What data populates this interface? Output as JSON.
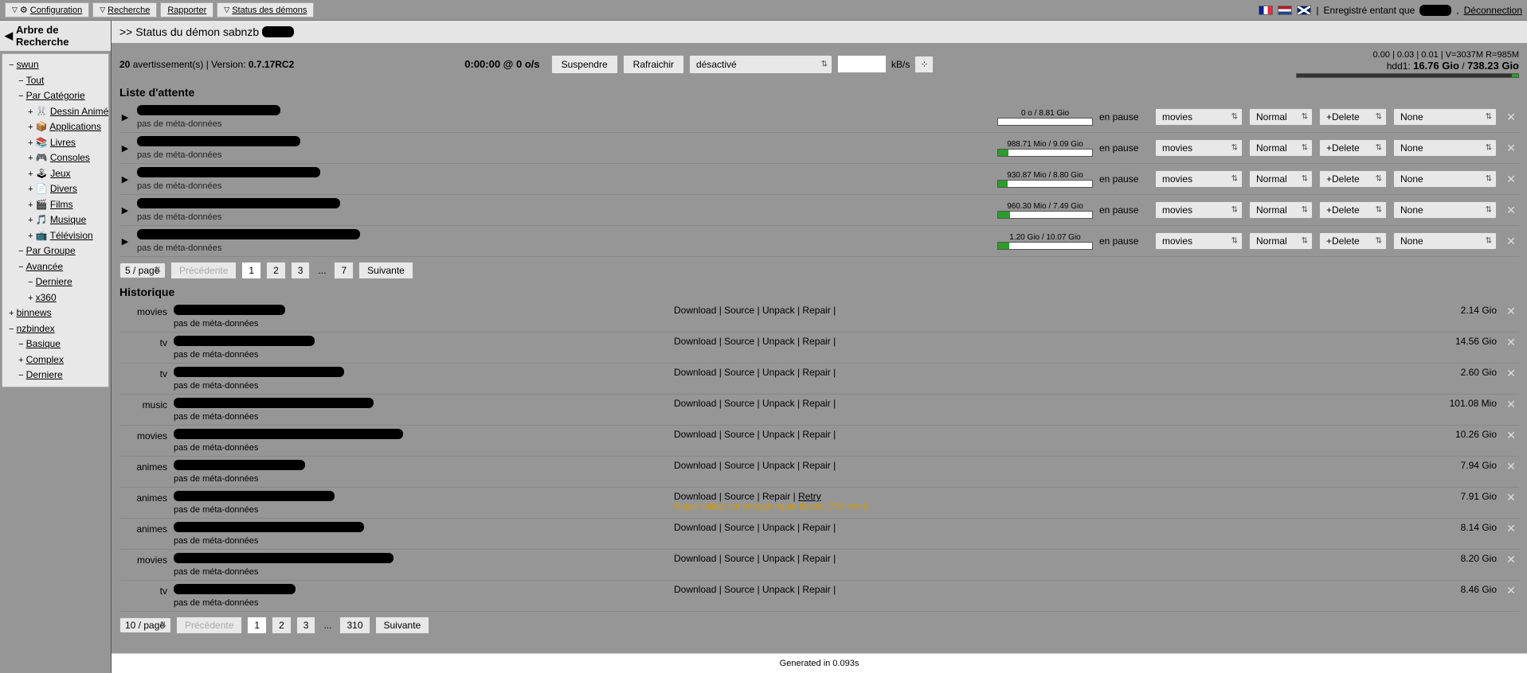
{
  "topbar": {
    "config": "Configuration",
    "search": "Recherche",
    "report": "Rapporter",
    "daemons": "Status des démons",
    "logged_as_prefix": "Enregistré entant que",
    "logout": "Déconnection"
  },
  "sidebar": {
    "title": "Arbre de Recherche",
    "tree": {
      "swun": "swun",
      "tout": "Tout",
      "par_cat": "Par Catégorie",
      "cat_dessin": "Dessin Animé",
      "cat_apps": "Applications",
      "cat_livres": "Livres",
      "cat_consoles": "Consoles",
      "cat_jeux": "Jeux",
      "cat_divers": "Divers",
      "cat_films": "Films",
      "cat_musique": "Musique",
      "cat_tv": "Télévision",
      "par_grp": "Par Groupe",
      "avancee": "Avancée",
      "derniere": "Derniere",
      "x360": "x360",
      "binnews": "binnews",
      "nzbindex": "nzbindex",
      "basique": "Basique",
      "complex": "Complex",
      "derniere2": "Derniere"
    }
  },
  "main": {
    "title_prefix": ">> Status du démon sabnzb",
    "warnings_count": "20",
    "warnings_label": "avertissement(s) | Version:",
    "version": "0.7.17RC2",
    "time_speed": "0:00:00 @ 0 o/s",
    "suspend": "Suspendre",
    "refresh": "Rafraichir",
    "state": "désactivé",
    "kbs_label": "kB/s",
    "stats_line": "0.00 | 0.03 | 0.01 | V=3037M R=985M",
    "hdd_label": "hdd1:",
    "hdd_used": "16.76 Gio",
    "hdd_sep": "/",
    "hdd_total": "738.23 Gio"
  },
  "queue": {
    "title": "Liste d'attente",
    "meta_none": "pas de méta-données",
    "status_pause": "en pause",
    "cat_movies": "movies",
    "prio_normal": "Normal",
    "pp_delete": "+Delete",
    "script_none": "None",
    "items": [
      {
        "progress_label": "0 o / 8.81 Gio",
        "progress_pct": 0
      },
      {
        "progress_label": "988.71 Mio / 9.09 Gio",
        "progress_pct": 11
      },
      {
        "progress_label": "930.87 Mio / 8.80 Gio",
        "progress_pct": 10
      },
      {
        "progress_label": "960.30 Mio / 7.49 Gio",
        "progress_pct": 13
      },
      {
        "progress_label": "1.20 Gio / 10.07 Gio",
        "progress_pct": 12
      }
    ],
    "pag": {
      "per": "5 / page",
      "prev": "Précédente",
      "next": "Suivante",
      "p1": "1",
      "p2": "2",
      "p3": "3",
      "dots": "...",
      "p7": "7"
    }
  },
  "history": {
    "title": "Historique",
    "meta_none": "pas de méta-données",
    "stages_full": "Download | Source | Unpack | Repair |",
    "stages_repair": "Download | Source | Repair |",
    "retry": "Retry",
    "err_msg": "Repair failed, not enough repair blocks (750 short)",
    "items": [
      {
        "cat": "movies",
        "size": "2.14 Gio",
        "type": "full"
      },
      {
        "cat": "tv",
        "size": "14.56 Gio",
        "type": "full"
      },
      {
        "cat": "tv",
        "size": "2.60 Gio",
        "type": "full"
      },
      {
        "cat": "music",
        "size": "101.08 Mio",
        "type": "full"
      },
      {
        "cat": "movies",
        "size": "10.26 Gio",
        "type": "full"
      },
      {
        "cat": "animes",
        "size": "7.94 Gio",
        "type": "full"
      },
      {
        "cat": "animes",
        "size": "7.91 Gio",
        "type": "retry"
      },
      {
        "cat": "animes",
        "size": "8.14 Gio",
        "type": "full"
      },
      {
        "cat": "movies",
        "size": "8.20 Gio",
        "type": "full"
      },
      {
        "cat": "tv",
        "size": "8.46 Gio",
        "type": "full"
      }
    ],
    "pag": {
      "per": "10 / page",
      "prev": "Précédente",
      "next": "Suivante",
      "p1": "1",
      "p2": "2",
      "p3": "3",
      "dots": "...",
      "p310": "310"
    }
  },
  "footer": "Generated in 0.093s"
}
